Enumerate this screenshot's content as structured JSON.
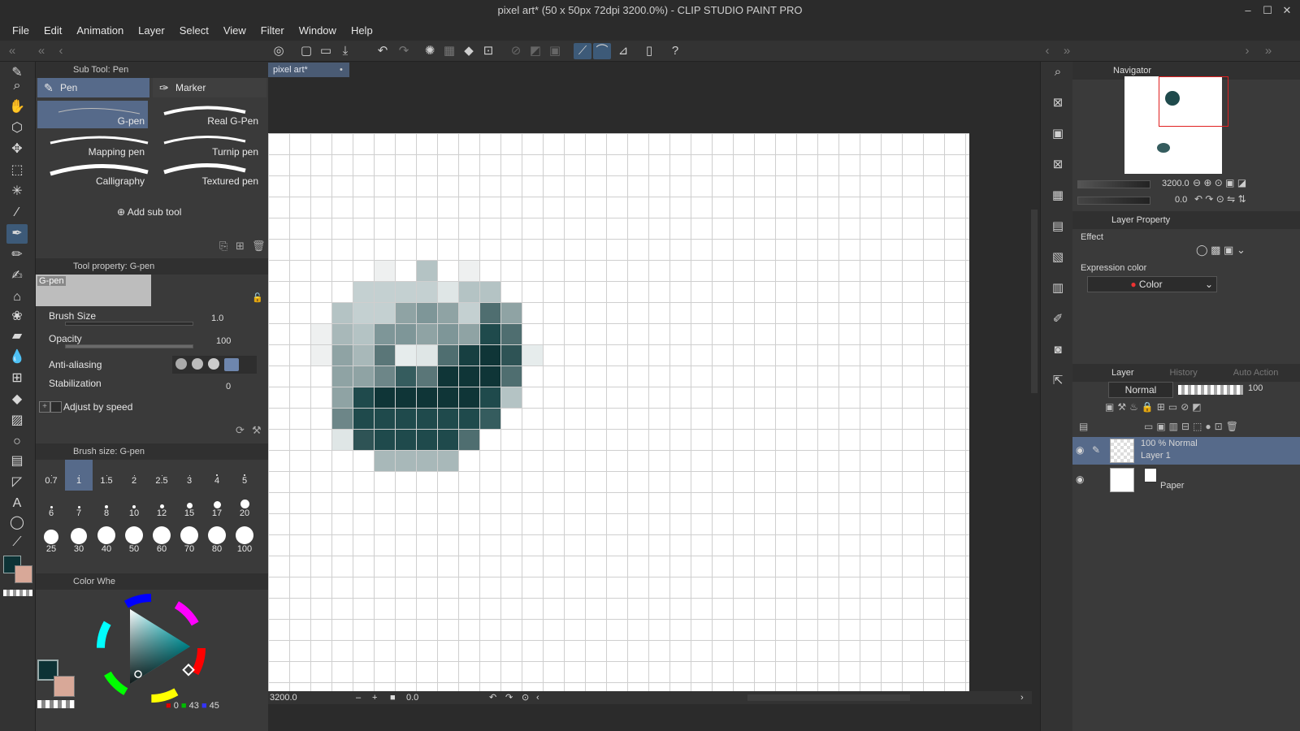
{
  "window": {
    "title": "pixel art* (50 x 50px 72dpi 3200.0%) - CLIP STUDIO PAINT PRO",
    "controls": [
      "–",
      "☐",
      "✕"
    ]
  },
  "menu": [
    "File",
    "Edit",
    "Animation",
    "Layer",
    "Select",
    "View",
    "Filter",
    "Window",
    "Help"
  ],
  "subtool": {
    "header": "Sub Tool: Pen",
    "tabs": [
      "Pen",
      "Marker"
    ],
    "brushes": [
      "G-pen",
      "Real G-Pen",
      "Mapping pen",
      "Turnip pen",
      "Calligraphy",
      "Textured pen"
    ],
    "add_label": "Add sub tool"
  },
  "toolprop": {
    "header": "Tool property: G-pen",
    "preview_label": "G-pen",
    "brush_size_label": "Brush Size",
    "brush_size_value": "1.0",
    "opacity_label": "Opacity",
    "opacity_value": "100",
    "antialias_label": "Anti-aliasing",
    "stabilization_label": "Stabilization",
    "stabilization_value": "0",
    "adjust_label": "Adjust by speed"
  },
  "brushsize": {
    "header": "Brush size: G-pen",
    "sizes": [
      "0.7",
      "1",
      "1.5",
      "2",
      "2.5",
      "3",
      "4",
      "5",
      "6",
      "7",
      "8",
      "10",
      "12",
      "15",
      "17",
      "20",
      "25",
      "30",
      "40",
      "50",
      "60",
      "70",
      "80",
      "100"
    ]
  },
  "colorwheel": {
    "header": "Color Whe",
    "r": "0",
    "g": "43",
    "b": "45",
    "main_color": "#0d3336",
    "sub_color": "#d8a898"
  },
  "document": {
    "tab": "pixel art*",
    "zoom": "3200.0",
    "rotation": "0.0"
  },
  "navigator": {
    "header": "Navigator",
    "zoom": "3200.0",
    "angle": "0.0"
  },
  "layerprop": {
    "header": "Layer Property",
    "effect_label": "Effect",
    "expression_label": "Expression color",
    "expression_value": "Color"
  },
  "layers": {
    "tabs": [
      "Layer",
      "History",
      "Auto Action"
    ],
    "blend": "Normal",
    "opacity": "100",
    "items": [
      {
        "info": "100 % Normal",
        "name": "Layer 1"
      },
      {
        "info": "",
        "name": "Paper"
      }
    ]
  },
  "pixels": [
    [
      5,
      6,
      "#eef0f0"
    ],
    [
      7,
      6,
      "#b4c3c4"
    ],
    [
      9,
      6,
      "#eef0f0"
    ],
    [
      4,
      7,
      "#c4d0d1"
    ],
    [
      5,
      7,
      "#c4d0d1"
    ],
    [
      6,
      7,
      "#c4d0d1"
    ],
    [
      7,
      7,
      "#c4d0d1"
    ],
    [
      8,
      7,
      "#dfe6e6"
    ],
    [
      9,
      7,
      "#b4c3c4"
    ],
    [
      10,
      7,
      "#b4c3c4"
    ],
    [
      3,
      8,
      "#b4c3c4"
    ],
    [
      4,
      8,
      "#c4d0d1"
    ],
    [
      5,
      8,
      "#c4d0d1"
    ],
    [
      6,
      8,
      "#8fa3a4"
    ],
    [
      7,
      8,
      "#7e9698"
    ],
    [
      8,
      8,
      "#8fa3a4"
    ],
    [
      9,
      8,
      "#c4d0d1"
    ],
    [
      10,
      8,
      "#4f6e70"
    ],
    [
      11,
      8,
      "#8fa3a4"
    ],
    [
      2,
      9,
      "#eef0f0"
    ],
    [
      3,
      9,
      "#a8b8b9"
    ],
    [
      4,
      9,
      "#b4c3c4"
    ],
    [
      5,
      9,
      "#7e9698"
    ],
    [
      6,
      9,
      "#7e9698"
    ],
    [
      7,
      9,
      "#8fa3a4"
    ],
    [
      8,
      9,
      "#7e9698"
    ],
    [
      9,
      9,
      "#8fa3a4"
    ],
    [
      10,
      9,
      "#1f4a4c"
    ],
    [
      11,
      9,
      "#4f6e70"
    ],
    [
      2,
      10,
      "#eef0f0"
    ],
    [
      3,
      10,
      "#8fa3a4"
    ],
    [
      4,
      10,
      "#a8b8b9"
    ],
    [
      5,
      10,
      "#5a7678"
    ],
    [
      6,
      10,
      "#e6ecec"
    ],
    [
      7,
      10,
      "#dfe6e6"
    ],
    [
      8,
      10,
      "#4f6e70"
    ],
    [
      9,
      10,
      "#173f41"
    ],
    [
      10,
      10,
      "#0f3537"
    ],
    [
      11,
      10,
      "#2e5355"
    ],
    [
      12,
      10,
      "#e6ecec"
    ],
    [
      3,
      11,
      "#8fa3a4"
    ],
    [
      4,
      11,
      "#8fa3a4"
    ],
    [
      5,
      11,
      "#6d8688"
    ],
    [
      6,
      11,
      "#355c5e"
    ],
    [
      7,
      11,
      "#5a7678"
    ],
    [
      8,
      11,
      "#0f3537"
    ],
    [
      9,
      11,
      "#0f3537"
    ],
    [
      10,
      11,
      "#0f3537"
    ],
    [
      11,
      11,
      "#4f6e70"
    ],
    [
      3,
      12,
      "#8fa3a4"
    ],
    [
      4,
      12,
      "#1f4a4c"
    ],
    [
      5,
      12,
      "#0f3537"
    ],
    [
      6,
      12,
      "#0f3537"
    ],
    [
      7,
      12,
      "#0f3537"
    ],
    [
      8,
      12,
      "#0f3537"
    ],
    [
      9,
      12,
      "#0f3537"
    ],
    [
      10,
      12,
      "#1f4a4c"
    ],
    [
      11,
      12,
      "#b4c3c4"
    ],
    [
      3,
      13,
      "#6d8688"
    ],
    [
      4,
      13,
      "#1f4a4c"
    ],
    [
      5,
      13,
      "#1f4a4c"
    ],
    [
      6,
      13,
      "#1f4a4c"
    ],
    [
      7,
      13,
      "#1f4a4c"
    ],
    [
      8,
      13,
      "#1f4a4c"
    ],
    [
      9,
      13,
      "#1f4a4c"
    ],
    [
      10,
      13,
      "#355c5e"
    ],
    [
      3,
      14,
      "#dfe6e6"
    ],
    [
      4,
      14,
      "#2e5355"
    ],
    [
      5,
      14,
      "#1f4a4c"
    ],
    [
      6,
      14,
      "#1f4a4c"
    ],
    [
      7,
      14,
      "#1f4a4c"
    ],
    [
      8,
      14,
      "#1f4a4c"
    ],
    [
      9,
      14,
      "#4f6e70"
    ],
    [
      5,
      15,
      "#a8b8b9"
    ],
    [
      6,
      15,
      "#a8b8b9"
    ],
    [
      7,
      15,
      "#a8b8b9"
    ],
    [
      8,
      15,
      "#a8b8b9"
    ]
  ]
}
